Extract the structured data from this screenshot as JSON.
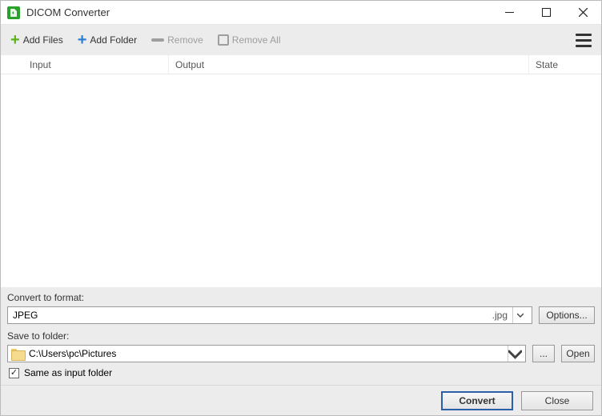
{
  "window": {
    "title": "DICOM Converter"
  },
  "toolbar": {
    "add_files": "Add Files",
    "add_folder": "Add Folder",
    "remove": "Remove",
    "remove_all": "Remove All"
  },
  "table": {
    "headers": {
      "input": "Input",
      "output": "Output",
      "state": "State"
    }
  },
  "convert": {
    "format_label": "Convert to format:",
    "format_value": "JPEG",
    "format_ext": ".jpg",
    "options_btn": "Options...",
    "folder_label": "Save to folder:",
    "folder_value": "C:\\Users\\pc\\Pictures",
    "browse_btn": "...",
    "open_btn": "Open",
    "same_folder_label": "Same as input folder",
    "same_folder_checked": true
  },
  "footer": {
    "convert_btn": "Convert",
    "close_btn": "Close"
  }
}
